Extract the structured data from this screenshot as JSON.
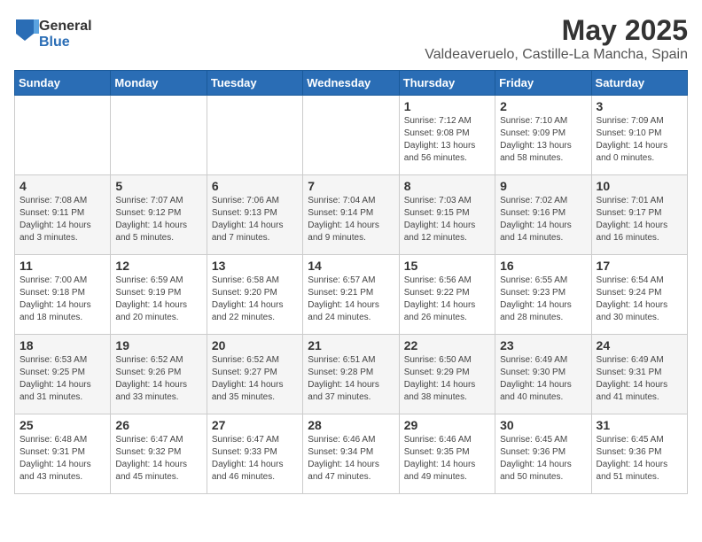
{
  "header": {
    "logo_general": "General",
    "logo_blue": "Blue",
    "title": "May 2025",
    "subtitle": "Valdeaveruelo, Castille-La Mancha, Spain"
  },
  "days_of_week": [
    "Sunday",
    "Monday",
    "Tuesday",
    "Wednesday",
    "Thursday",
    "Friday",
    "Saturday"
  ],
  "weeks": [
    [
      {
        "day": "",
        "sunrise": "",
        "sunset": "",
        "daylight": ""
      },
      {
        "day": "",
        "sunrise": "",
        "sunset": "",
        "daylight": ""
      },
      {
        "day": "",
        "sunrise": "",
        "sunset": "",
        "daylight": ""
      },
      {
        "day": "",
        "sunrise": "",
        "sunset": "",
        "daylight": ""
      },
      {
        "day": "1",
        "sunrise": "7:12 AM",
        "sunset": "9:08 PM",
        "daylight": "13 hours and 56 minutes."
      },
      {
        "day": "2",
        "sunrise": "7:10 AM",
        "sunset": "9:09 PM",
        "daylight": "13 hours and 58 minutes."
      },
      {
        "day": "3",
        "sunrise": "7:09 AM",
        "sunset": "9:10 PM",
        "daylight": "14 hours and 0 minutes."
      }
    ],
    [
      {
        "day": "4",
        "sunrise": "7:08 AM",
        "sunset": "9:11 PM",
        "daylight": "14 hours and 3 minutes."
      },
      {
        "day": "5",
        "sunrise": "7:07 AM",
        "sunset": "9:12 PM",
        "daylight": "14 hours and 5 minutes."
      },
      {
        "day": "6",
        "sunrise": "7:06 AM",
        "sunset": "9:13 PM",
        "daylight": "14 hours and 7 minutes."
      },
      {
        "day": "7",
        "sunrise": "7:04 AM",
        "sunset": "9:14 PM",
        "daylight": "14 hours and 9 minutes."
      },
      {
        "day": "8",
        "sunrise": "7:03 AM",
        "sunset": "9:15 PM",
        "daylight": "14 hours and 12 minutes."
      },
      {
        "day": "9",
        "sunrise": "7:02 AM",
        "sunset": "9:16 PM",
        "daylight": "14 hours and 14 minutes."
      },
      {
        "day": "10",
        "sunrise": "7:01 AM",
        "sunset": "9:17 PM",
        "daylight": "14 hours and 16 minutes."
      }
    ],
    [
      {
        "day": "11",
        "sunrise": "7:00 AM",
        "sunset": "9:18 PM",
        "daylight": "14 hours and 18 minutes."
      },
      {
        "day": "12",
        "sunrise": "6:59 AM",
        "sunset": "9:19 PM",
        "daylight": "14 hours and 20 minutes."
      },
      {
        "day": "13",
        "sunrise": "6:58 AM",
        "sunset": "9:20 PM",
        "daylight": "14 hours and 22 minutes."
      },
      {
        "day": "14",
        "sunrise": "6:57 AM",
        "sunset": "9:21 PM",
        "daylight": "14 hours and 24 minutes."
      },
      {
        "day": "15",
        "sunrise": "6:56 AM",
        "sunset": "9:22 PM",
        "daylight": "14 hours and 26 minutes."
      },
      {
        "day": "16",
        "sunrise": "6:55 AM",
        "sunset": "9:23 PM",
        "daylight": "14 hours and 28 minutes."
      },
      {
        "day": "17",
        "sunrise": "6:54 AM",
        "sunset": "9:24 PM",
        "daylight": "14 hours and 30 minutes."
      }
    ],
    [
      {
        "day": "18",
        "sunrise": "6:53 AM",
        "sunset": "9:25 PM",
        "daylight": "14 hours and 31 minutes."
      },
      {
        "day": "19",
        "sunrise": "6:52 AM",
        "sunset": "9:26 PM",
        "daylight": "14 hours and 33 minutes."
      },
      {
        "day": "20",
        "sunrise": "6:52 AM",
        "sunset": "9:27 PM",
        "daylight": "14 hours and 35 minutes."
      },
      {
        "day": "21",
        "sunrise": "6:51 AM",
        "sunset": "9:28 PM",
        "daylight": "14 hours and 37 minutes."
      },
      {
        "day": "22",
        "sunrise": "6:50 AM",
        "sunset": "9:29 PM",
        "daylight": "14 hours and 38 minutes."
      },
      {
        "day": "23",
        "sunrise": "6:49 AM",
        "sunset": "9:30 PM",
        "daylight": "14 hours and 40 minutes."
      },
      {
        "day": "24",
        "sunrise": "6:49 AM",
        "sunset": "9:31 PM",
        "daylight": "14 hours and 41 minutes."
      }
    ],
    [
      {
        "day": "25",
        "sunrise": "6:48 AM",
        "sunset": "9:31 PM",
        "daylight": "14 hours and 43 minutes."
      },
      {
        "day": "26",
        "sunrise": "6:47 AM",
        "sunset": "9:32 PM",
        "daylight": "14 hours and 45 minutes."
      },
      {
        "day": "27",
        "sunrise": "6:47 AM",
        "sunset": "9:33 PM",
        "daylight": "14 hours and 46 minutes."
      },
      {
        "day": "28",
        "sunrise": "6:46 AM",
        "sunset": "9:34 PM",
        "daylight": "14 hours and 47 minutes."
      },
      {
        "day": "29",
        "sunrise": "6:46 AM",
        "sunset": "9:35 PM",
        "daylight": "14 hours and 49 minutes."
      },
      {
        "day": "30",
        "sunrise": "6:45 AM",
        "sunset": "9:36 PM",
        "daylight": "14 hours and 50 minutes."
      },
      {
        "day": "31",
        "sunrise": "6:45 AM",
        "sunset": "9:36 PM",
        "daylight": "14 hours and 51 minutes."
      }
    ]
  ]
}
